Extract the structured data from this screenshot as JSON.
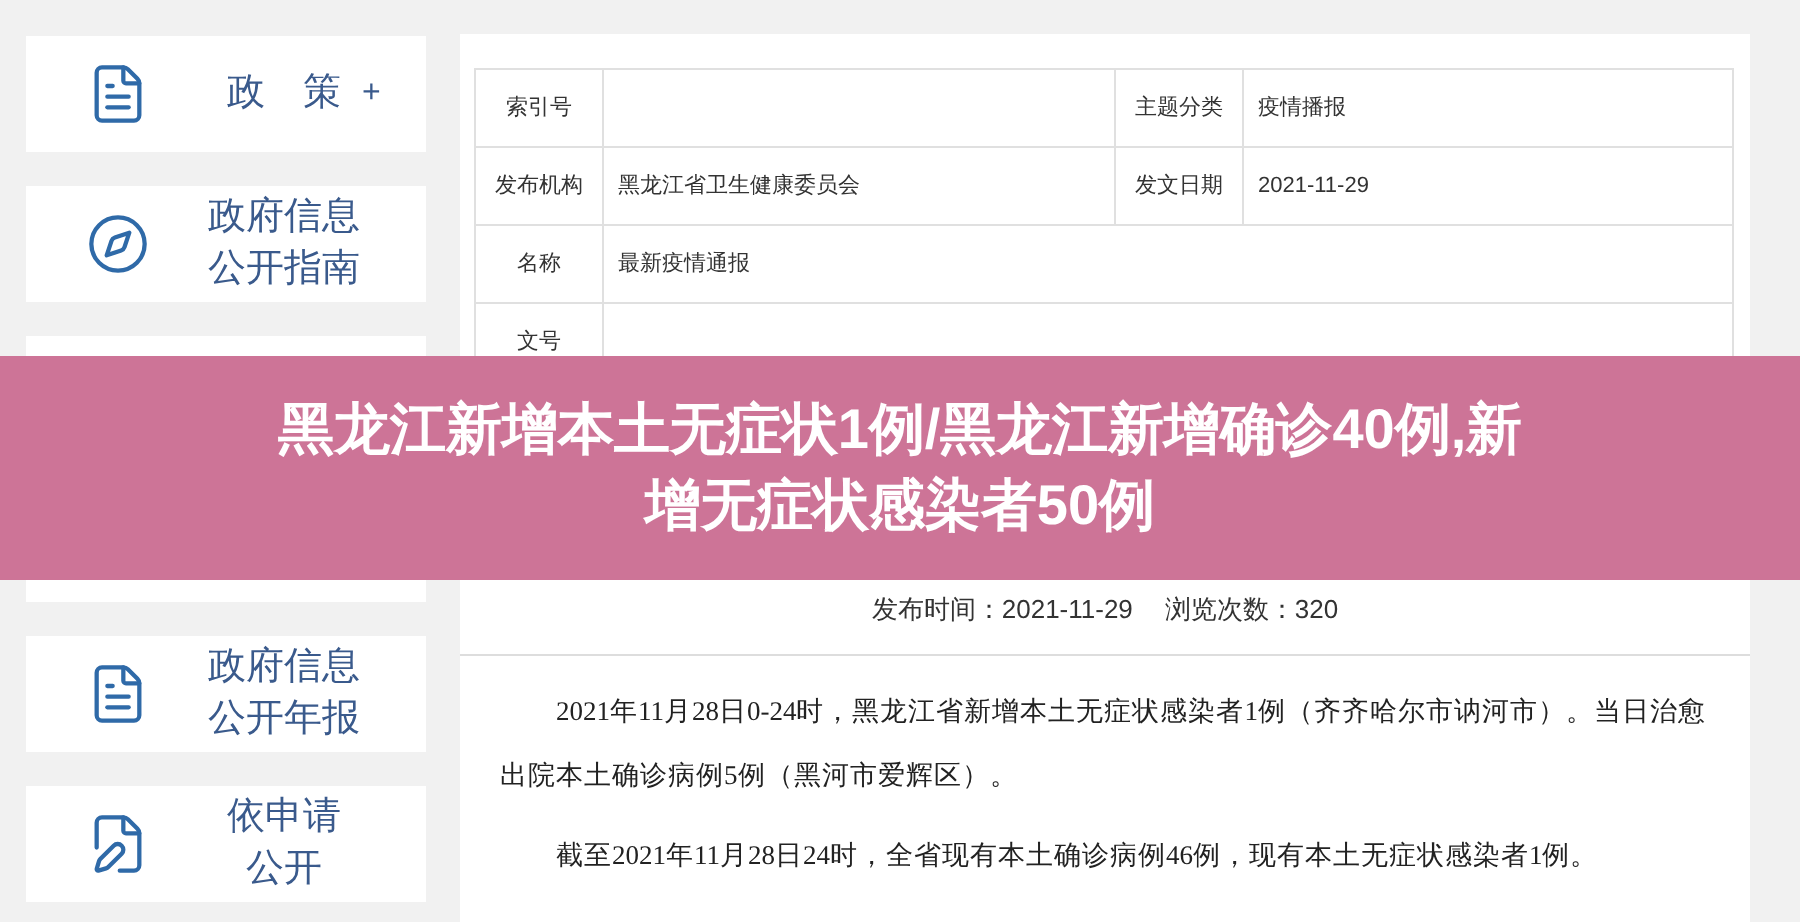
{
  "sidebar": {
    "items": [
      {
        "kind": "entry",
        "lines": [
          "政　策"
        ],
        "plus": "+"
      },
      {
        "kind": "entry",
        "lines": [
          "政府信息",
          "公开指南"
        ]
      },
      {
        "kind": "covered"
      },
      {
        "kind": "covered"
      },
      {
        "kind": "entry",
        "lines": [
          "政府信息",
          "公开年报"
        ]
      },
      {
        "kind": "entry",
        "lines": [
          "依申请",
          "公开"
        ]
      }
    ]
  },
  "info_table": {
    "rows": [
      {
        "kind": "pair",
        "label": "索引号",
        "label_2": "主题分类",
        "value_2": "疫情播报"
      },
      {
        "kind": "pair",
        "label": "发布机构",
        "value": "黑龙江省卫生健康委员会",
        "label_2": "发文日期",
        "value_2": "2021-11-29"
      },
      {
        "kind": "wide",
        "label": "名称",
        "value": "最新疫情通报"
      },
      {
        "kind": "wide",
        "label": "文号"
      }
    ]
  },
  "banner": {
    "lines": [
      "黑龙江新增本土无症状1例/黑龙江新增确诊40例,新",
      "增无症状感染者50例"
    ]
  },
  "meta": {
    "published": "发布时间：2021-11-29",
    "views": "浏览次数：320"
  },
  "paragraphs": [
    "2021年11月28日0-24时，黑龙江省新增本土无症状感染者1例（齐齐哈尔市讷河市）。当日治愈出院本土确诊病例5例（黑河市爱辉区）。",
    "截至2021年11月28日24时，全省现有本土确诊病例46例，现有本土无症状感染者1例。"
  ]
}
